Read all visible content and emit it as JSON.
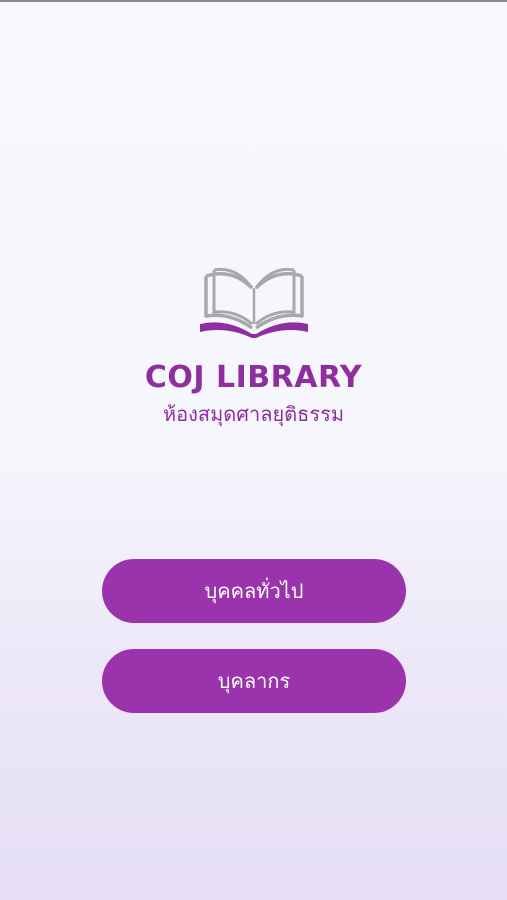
{
  "brand": {
    "title": "COJ LIBRARY",
    "subtitle": "ห้องสมุดศาลยุติธรรม",
    "logo_icon": "open-book-icon"
  },
  "buttons": {
    "general_public": "บุคคลทั่วไป",
    "staff": "บุคลากร"
  },
  "colors": {
    "primary": "#9b33ad",
    "brand_text": "#8f2f9f",
    "logo_gray": "#a8a8a8"
  }
}
